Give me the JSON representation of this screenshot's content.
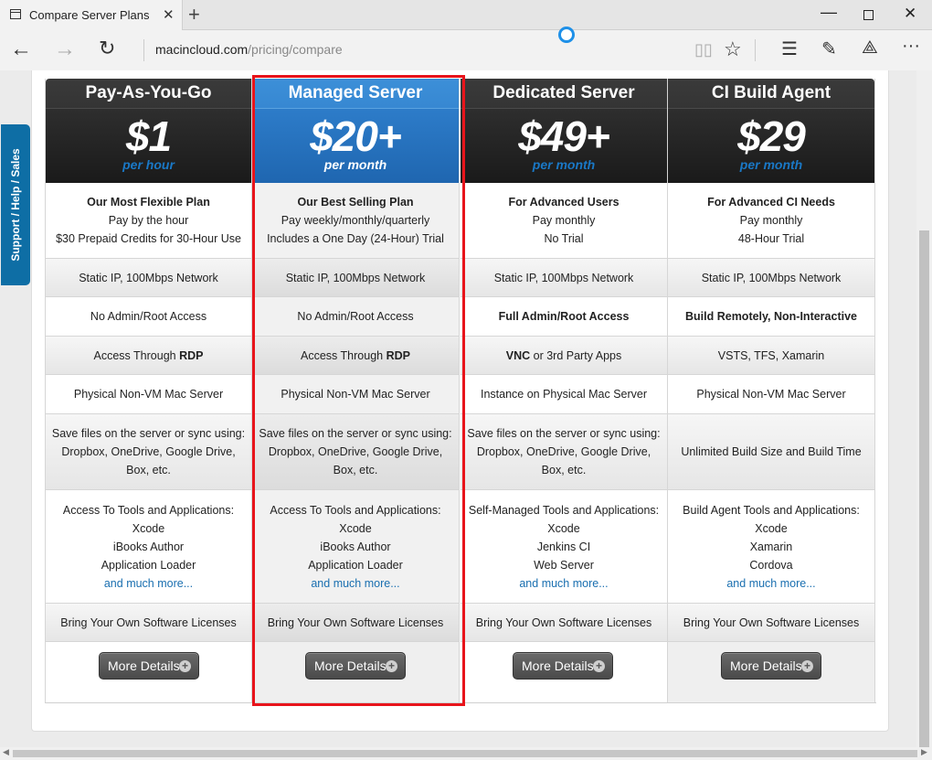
{
  "browser": {
    "tab_title": "Compare Server Plans",
    "new_tab": "+",
    "url_domain": "macincloud.com",
    "url_path": "/pricing/compare"
  },
  "side_tab": {
    "label": "Support / Help / Sales"
  },
  "plans": [
    {
      "name": "Pay-As-You-Go",
      "price": "$1",
      "period": "per hour",
      "intro": [
        "Our Most Flexible Plan",
        "Pay by the hour",
        "$30 Prepaid Credits for 30-Hour Use"
      ],
      "network": "Static IP, 100Mbps Network",
      "access": "No Admin/Root Access",
      "remote_prefix": "Access Through ",
      "remote_bold": "RDP",
      "remote_suffix": "",
      "hardware": "Physical Non-VM Mac Server",
      "storage": [
        "Save files on the server or sync using:",
        "Dropbox, OneDrive, Google Drive,",
        "Box, etc."
      ],
      "tools": [
        "Access To Tools and Applications:",
        "Xcode",
        "iBooks Author",
        "Application Loader"
      ],
      "tools_more": "and much more...",
      "licenses": "Bring Your Own Software Licenses",
      "details_button": "More Details"
    },
    {
      "name": "Managed Server",
      "price": "$20+",
      "period": "per month",
      "intro": [
        "Our Best Selling Plan",
        "Pay weekly/monthly/quarterly",
        "Includes a One Day (24-Hour) Trial"
      ],
      "network": "Static IP, 100Mbps Network",
      "access": "No Admin/Root Access",
      "remote_prefix": "Access Through ",
      "remote_bold": "RDP",
      "remote_suffix": "",
      "hardware": "Physical Non-VM Mac Server",
      "storage": [
        "Save files on the server or sync using:",
        "Dropbox, OneDrive, Google Drive,",
        "Box, etc."
      ],
      "tools": [
        "Access To Tools and Applications:",
        "Xcode",
        "iBooks Author",
        "Application Loader"
      ],
      "tools_more": "and much more...",
      "licenses": "Bring Your Own Software Licenses",
      "details_button": "More Details"
    },
    {
      "name": "Dedicated Server",
      "price": "$49+",
      "period": "per month",
      "intro": [
        "For Advanced Users",
        "Pay monthly",
        "No Trial"
      ],
      "network": "Static IP, 100Mbps Network",
      "access": "Full Admin/Root Access",
      "remote_prefix": "",
      "remote_bold": "VNC",
      "remote_suffix": " or 3rd Party Apps",
      "hardware": "Instance on Physical Mac Server",
      "storage": [
        "Save files on the server or sync using:",
        "Dropbox, OneDrive, Google Drive,",
        "Box, etc."
      ],
      "tools": [
        "Self-Managed Tools and Applications:",
        "Xcode",
        "Jenkins CI",
        "Web Server"
      ],
      "tools_more": "and much more...",
      "licenses": "Bring Your Own Software Licenses",
      "details_button": "More Details"
    },
    {
      "name": "CI Build Agent",
      "price": "$29",
      "period": "per month",
      "intro": [
        "For Advanced CI Needs",
        "Pay monthly",
        "48-Hour Trial"
      ],
      "network": "Static IP, 100Mbps Network",
      "access": "Build Remotely, Non-Interactive",
      "remote_prefix": "VSTS, TFS, Xamarin",
      "remote_bold": "",
      "remote_suffix": "",
      "hardware": "Physical Non-VM Mac Server",
      "storage": [
        "Unlimited Build Size and Build Time"
      ],
      "tools": [
        "Build Agent Tools and Applications:",
        "Xcode",
        "Xamarin",
        "Cordova"
      ],
      "tools_more": "and much more...",
      "licenses": "Bring Your Own Software Licenses",
      "details_button": "More Details"
    }
  ],
  "colors": {
    "highlight_blue": "#2a75c2",
    "period_blue": "#1a78c6",
    "link_blue": "#1a6fb0",
    "frame_red": "#e8141b"
  }
}
